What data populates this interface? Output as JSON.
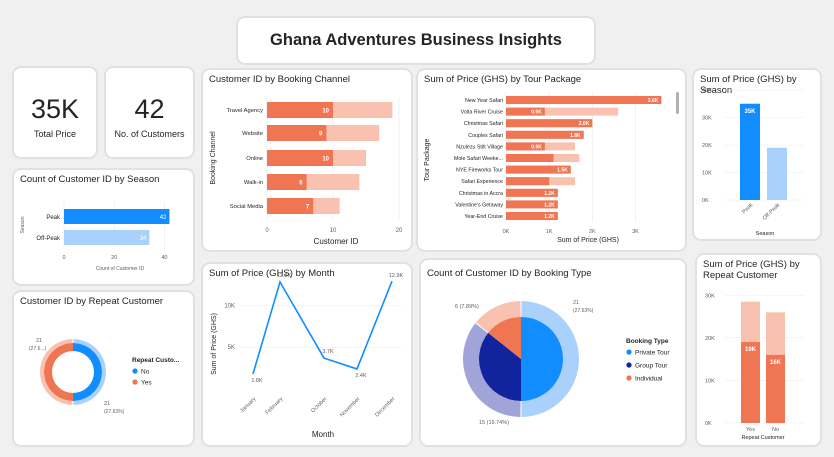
{
  "header": {
    "title": "Ghana Adventures Business Insights"
  },
  "kpi": {
    "total_price": {
      "value": "35K",
      "label": "Total Price"
    },
    "customers": {
      "value": "42",
      "label": "No. of Customers"
    }
  },
  "titles": {
    "season_count": "Count of Customer ID by Season",
    "repeat_donut": "Customer ID by Repeat Customer",
    "channel": "Customer ID by Booking Channel",
    "month": "Sum of Price (GHS) by Month",
    "package": "Sum of Price (GHS) by Tour Package",
    "booking_type": "Count of Customer ID by Booking Type",
    "season_price_1": "Sum of Price (GHS) by",
    "season_price_2": "Season",
    "repeat_price_1": "Sum of Price (GHS) by",
    "repeat_price_2": "Repeat Customer"
  },
  "colors": {
    "blue": "#118dff",
    "lightblue": "#a9d1fb",
    "orange": "#f07552",
    "peach": "#f9c2b0",
    "navy": "#12239e",
    "lavender": "#a1a4d9",
    "line": "#118dff"
  },
  "chart_data": [
    {
      "id": "season_count",
      "type": "bar",
      "orientation": "horizontal",
      "categories": [
        "Peak",
        "Off-Peak"
      ],
      "values": [
        42,
        34
      ],
      "value_labels": [
        "42",
        "34"
      ],
      "xlabel": "Count of Customer ID",
      "ylabel": "Season",
      "xlim": [
        0,
        45
      ],
      "xticks": [
        "0",
        "20",
        "40"
      ],
      "xtick_values": [
        0,
        20,
        40
      ]
    },
    {
      "id": "repeat_donut",
      "type": "pie",
      "donut": true,
      "categories": [
        "No",
        "Yes"
      ],
      "values": [
        21,
        21
      ],
      "value_labels": [
        "21 (27.6...)",
        "21 (27.63%)"
      ],
      "legend_title": "Repeat Custo...",
      "legend_position": "right"
    },
    {
      "id": "channel",
      "type": "bar",
      "orientation": "horizontal",
      "categories": [
        "Travel Agency",
        "Website",
        "Online",
        "Walk-in",
        "Social Media"
      ],
      "values": [
        10,
        9,
        10,
        6,
        7
      ],
      "background_values": [
        19,
        17,
        15,
        14,
        11
      ],
      "value_labels": [
        "10",
        "9",
        "10",
        "6",
        "7"
      ],
      "xlabel": "Customer ID",
      "ylabel": "Booking Channel",
      "xlim": [
        0,
        20
      ],
      "xticks": [
        "0",
        "10",
        "20"
      ],
      "xtick_values": [
        0,
        10,
        20
      ]
    },
    {
      "id": "month",
      "type": "line",
      "categories": [
        "January",
        "February",
        "October",
        "November",
        "December"
      ],
      "values": [
        1.8,
        12.8,
        3.7,
        2.4,
        12.9
      ],
      "value_labels": [
        "1.8K",
        "12.8K",
        "3.7K",
        "2.4K",
        "12.9K"
      ],
      "xlabel": "Month",
      "ylabel": "Sum of Price (GHS)",
      "ylim": [
        0,
        14
      ],
      "yticks": [
        "5K",
        "10K"
      ],
      "ytick_values": [
        5,
        10
      ]
    },
    {
      "id": "package",
      "type": "bar",
      "orientation": "horizontal",
      "categories": [
        "New Year Safari",
        "Volta River Cruise",
        "Christmas Safari",
        "Couples Safari",
        "Nzulezu Stilt Village",
        "Mole Safari Weeke...",
        "NYE Fireworks Tour",
        "Safari Experience",
        "Christmas in Accra",
        "Valentine's Getaway",
        "Year-End Cruise"
      ],
      "values": [
        3.6,
        0.9,
        2.0,
        1.8,
        0.9,
        1.1,
        1.5,
        1.0,
        1.2,
        1.2,
        1.2
      ],
      "background_values": [
        3.6,
        2.6,
        2.0,
        1.8,
        1.6,
        1.7,
        1.5,
        1.6,
        1.2,
        1.2,
        1.2
      ],
      "value_labels": [
        "3.6K",
        "0.9K",
        "2.0K",
        "1.8K",
        "0.9K",
        "",
        "1.5K",
        "",
        "1.2K",
        "1.2K",
        "1.2K"
      ],
      "xlabel": "Sum of Price (GHS)",
      "ylabel": "Tour Package",
      "xlim": [
        0,
        3.8
      ],
      "xticks": [
        "0K",
        "1K",
        "2K",
        "3K"
      ],
      "xtick_values": [
        0,
        1,
        2,
        3
      ]
    },
    {
      "id": "booking_type",
      "type": "pie",
      "categories": [
        "Private Tour",
        "Group Tour",
        "Individual"
      ],
      "values": [
        21,
        15,
        6
      ],
      "value_labels": [
        "21 (27.63%)",
        "15 (19.74%)",
        "6 (7.89%)"
      ],
      "legend_title": "Booking Type",
      "legend_position": "right"
    },
    {
      "id": "season_price",
      "type": "bar",
      "categories": [
        "Peak",
        "Off-Peak"
      ],
      "values": [
        35,
        19
      ],
      "value_labels": [
        "35K",
        ""
      ],
      "xlabel": "Season",
      "ylim": [
        0,
        40
      ],
      "yticks": [
        "0K",
        "10K",
        "20K",
        "30K",
        "40K"
      ],
      "ytick_values": [
        0,
        10,
        20,
        30,
        40
      ]
    },
    {
      "id": "repeat_price",
      "type": "bar",
      "categories": [
        "Yes",
        "No"
      ],
      "values": [
        19,
        16
      ],
      "background_values": [
        28.5,
        26
      ],
      "value_labels": [
        "19K",
        "16K"
      ],
      "xlabel": "Repeat Customer",
      "ylim": [
        0,
        31
      ],
      "yticks": [
        "0K",
        "10K",
        "20K",
        "30K"
      ],
      "ytick_values": [
        0,
        10,
        20,
        30
      ]
    }
  ]
}
